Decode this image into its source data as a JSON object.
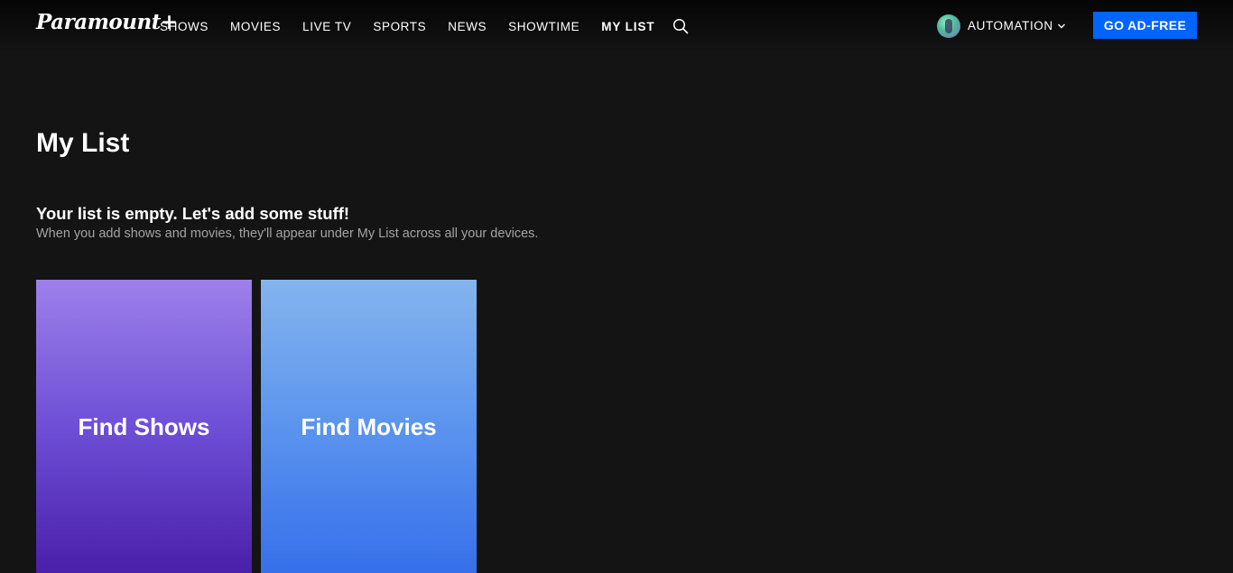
{
  "header": {
    "logo_text": "Paramount+",
    "nav": [
      {
        "label": "SHOWS",
        "active": false
      },
      {
        "label": "MOVIES",
        "active": false
      },
      {
        "label": "LIVE TV",
        "active": false
      },
      {
        "label": "SPORTS",
        "active": false
      },
      {
        "label": "NEWS",
        "active": false
      },
      {
        "label": "SHOWTIME",
        "active": false
      },
      {
        "label": "MY LIST",
        "active": true
      }
    ],
    "search_icon": "search-icon",
    "profile": {
      "name": "AUTOMATION",
      "icon": "chevron-down-icon"
    },
    "ad_free_label": "GO AD-FREE"
  },
  "main": {
    "title": "My List",
    "empty_heading": "Your list is empty. Let's add some stuff!",
    "empty_subtext": "When you add shows and movies, they'll appear under My List across all your devices.",
    "cards": [
      {
        "label": "Find Shows"
      },
      {
        "label": "Find Movies"
      }
    ]
  },
  "colors": {
    "background": "#141414",
    "accent": "#0064ff",
    "shows_gradient": [
      "#9d80ea",
      "#4a1faa"
    ],
    "movies_gradient": [
      "#84b4ee",
      "#3670ea"
    ]
  }
}
